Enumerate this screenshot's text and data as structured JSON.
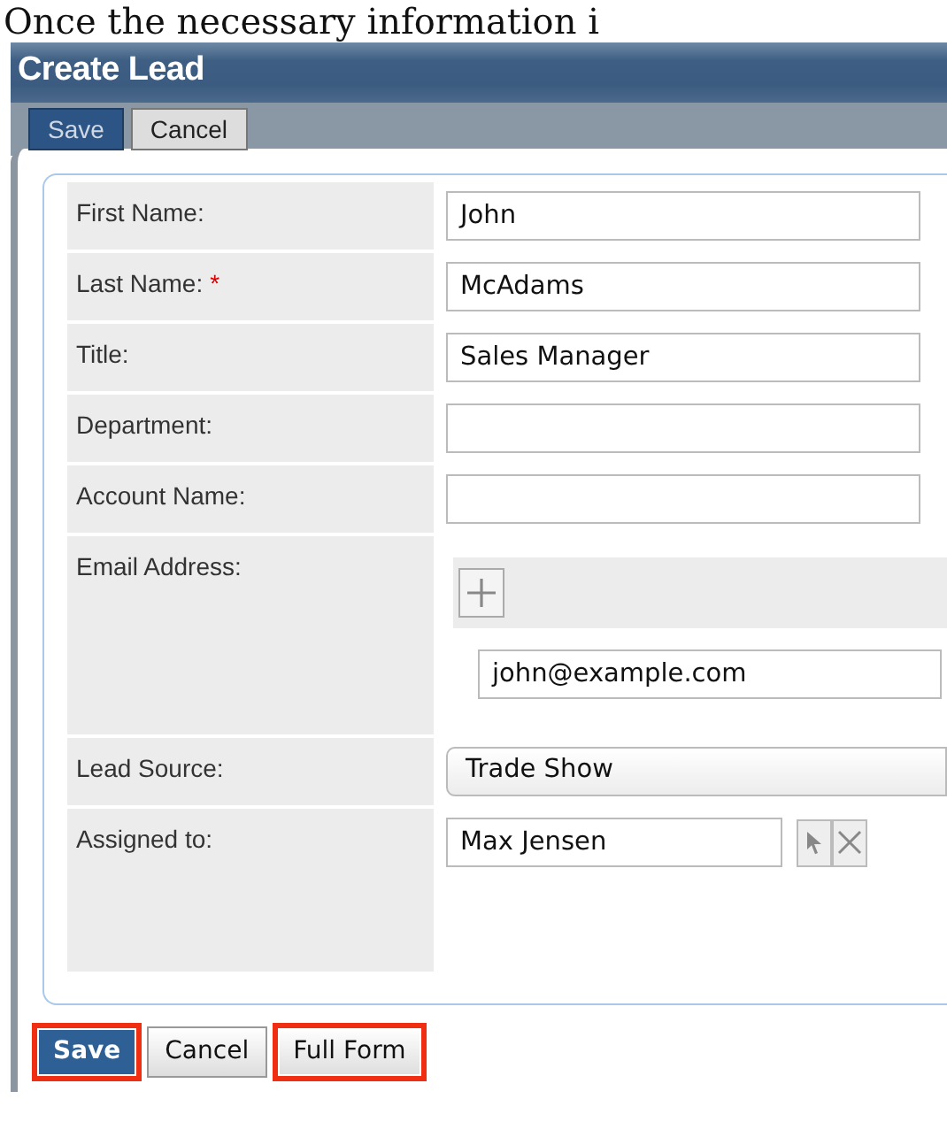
{
  "caption": "Once the necessary information i",
  "header": {
    "title": "Create Lead"
  },
  "toolbar": [
    {
      "label": "Save",
      "kind": "primary"
    },
    {
      "label": "Cancel",
      "kind": "default"
    }
  ],
  "fields": [
    {
      "label": "First Name:",
      "kind": "text",
      "value": "John"
    },
    {
      "label": "Last Name:",
      "required_mark": "*",
      "kind": "text",
      "value": "McAdams"
    },
    {
      "label": "Title:",
      "kind": "text",
      "value": "Sales Manager"
    },
    {
      "label": "Department:",
      "kind": "text"
    },
    {
      "label": "Account Name:",
      "kind": "text"
    },
    {
      "label": "Email Address:",
      "kind": "email",
      "value": "john@example.com"
    },
    {
      "label": "Lead Source:",
      "kind": "select",
      "value": "Trade Show"
    },
    {
      "label": "Assigned to:",
      "kind": "relate",
      "value": "Max Jensen"
    }
  ],
  "footer_buttons": [
    {
      "label": "Save",
      "kind": "primary",
      "highlighted": true
    },
    {
      "label": "Cancel",
      "kind": "default",
      "highlighted": false
    },
    {
      "label": "Full Form",
      "kind": "default",
      "highlighted": true
    }
  ]
}
